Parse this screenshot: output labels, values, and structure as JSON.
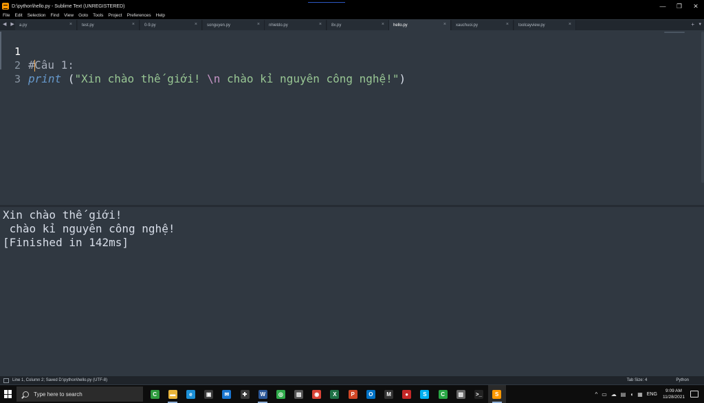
{
  "window": {
    "title": "D:\\python\\hello.py - Sublime Text (UNREGISTERED)",
    "controls": {
      "minimize": "—",
      "restore": "❐",
      "close": "✕"
    }
  },
  "menu": [
    "File",
    "Edit",
    "Selection",
    "Find",
    "View",
    "Goto",
    "Tools",
    "Project",
    "Preferences",
    "Help"
  ],
  "tabs": {
    "nav": "◀ ▶",
    "items": [
      {
        "label": "a.py",
        "close": "×"
      },
      {
        "label": "test.py",
        "close": "×"
      },
      {
        "label": "0-9.py",
        "close": "×"
      },
      {
        "label": "songuyen.py",
        "close": "×"
      },
      {
        "label": "nhietdo.py",
        "close": "×"
      },
      {
        "label": "8x.py",
        "close": "×"
      },
      {
        "label": "hello.py",
        "close": "×",
        "active": true
      },
      {
        "label": "xauchuoi.py",
        "close": "×"
      },
      {
        "label": "toolcayview.py",
        "close": "×"
      }
    ],
    "new_tab": "+",
    "more": "▾"
  },
  "editor": {
    "lines": [
      {
        "num": "1",
        "comment_hash": "#",
        "comment_text": "Câu 1:"
      },
      {
        "num": "2",
        "func": "print",
        "open": " (",
        "str_a": "\"Xin chào thế giới! ",
        "escape": "\\n",
        "str_b": " chào kỉ nguyên công nghệ!\"",
        "close": ")"
      },
      {
        "num": "3"
      }
    ]
  },
  "output": {
    "lines": [
      "Xin chào thế giới!",
      " chào kỉ nguyên công nghệ!",
      "[Finished in 142ms]"
    ]
  },
  "status": {
    "left": "Line 1, Column 2; Saved D:\\python\\hello.py (UTF-8)",
    "tab_size": "Tab Size: 4",
    "syntax": "Python"
  },
  "taskbar": {
    "search_placeholder": "Type here to search",
    "icons": [
      {
        "name": "green-app-icon",
        "glyph": "C",
        "color": "#2e9b3e",
        "running": false
      },
      {
        "name": "file-explorer-icon",
        "glyph": "▬",
        "color": "#e8b43a",
        "running": true
      },
      {
        "name": "edge-icon",
        "glyph": "e",
        "color": "#1b8fd6",
        "running": false
      },
      {
        "name": "store-icon",
        "glyph": "▣",
        "color": "#3a3a3a",
        "running": false
      },
      {
        "name": "mail-icon",
        "glyph": "✉",
        "color": "#1976d2",
        "running": false
      },
      {
        "name": "app-icon",
        "glyph": "✚",
        "color": "#3a3a3a",
        "running": false
      },
      {
        "name": "word-icon",
        "glyph": "W",
        "color": "#2b5797",
        "running": true
      },
      {
        "name": "green-circle-icon",
        "glyph": "◎",
        "color": "#2faa4a",
        "running": false
      },
      {
        "name": "photo-icon",
        "glyph": "▨",
        "color": "#555",
        "running": false
      },
      {
        "name": "chrome-icon",
        "glyph": "◉",
        "color": "#db4437",
        "running": false
      },
      {
        "name": "excel-icon",
        "glyph": "X",
        "color": "#1e7145",
        "running": false
      },
      {
        "name": "powerpoint-icon",
        "glyph": "P",
        "color": "#d24726",
        "running": false
      },
      {
        "name": "outlook-icon",
        "glyph": "O",
        "color": "#0072c6",
        "running": false
      },
      {
        "name": "m-app-icon",
        "glyph": "M",
        "color": "#333",
        "running": false
      },
      {
        "name": "record-icon",
        "glyph": "●",
        "color": "#c62828",
        "running": false
      },
      {
        "name": "skype-icon",
        "glyph": "S",
        "color": "#00aff0",
        "running": false
      },
      {
        "name": "green-c-icon",
        "glyph": "C",
        "color": "#29a745",
        "running": false
      },
      {
        "name": "image-app-icon",
        "glyph": "▧",
        "color": "#666",
        "running": false
      },
      {
        "name": "terminal-icon",
        "glyph": ">_",
        "color": "#222",
        "running": false
      },
      {
        "name": "sublime-text-icon",
        "glyph": "S",
        "color": "#ff9800",
        "running": true,
        "active": true
      }
    ],
    "tray": {
      "chevron": "^",
      "lang": "ENG",
      "time": "9:09 AM",
      "date": "11/28/2021"
    }
  }
}
